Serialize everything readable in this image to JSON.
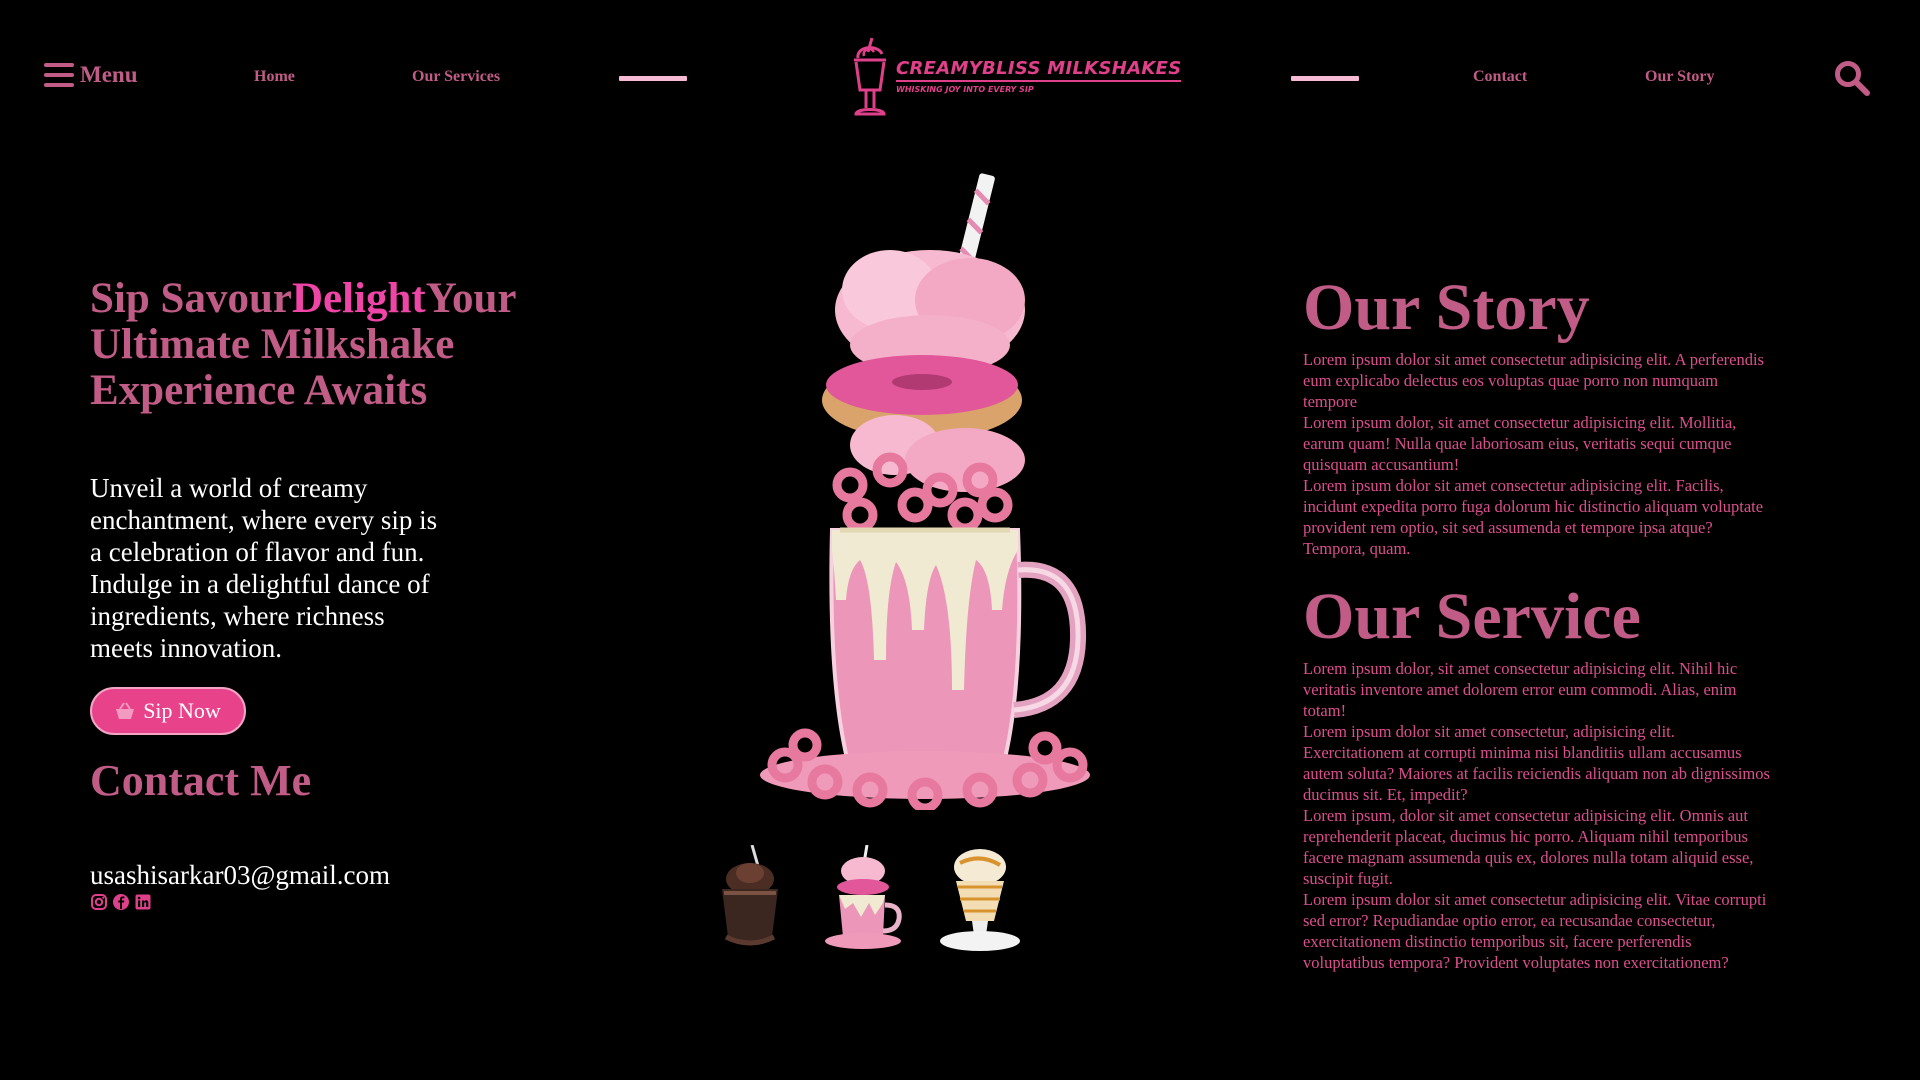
{
  "nav": {
    "menu_label": "Menu",
    "links": [
      "Home",
      "Our Services",
      "Contact",
      "Our Story"
    ],
    "logo_title": "CREAMYBLISS MILKSHAKES",
    "logo_tagline": "WHISKING JOY INTO EVERY SIP",
    "icons": [
      "hamburger-icon",
      "milkshake-glass-icon",
      "search-icon"
    ]
  },
  "hero": {
    "title_part1": "Sip Savour",
    "title_highlight": "Delight",
    "title_part2": "Your Ultimate Milkshake Experience Awaits",
    "description": "Unveil a world of creamy enchantment, where every sip is a celebration of flavor and fun. Indulge in a delightful dance of ingredients, where richness meets innovation.",
    "cta_label": "Sip Now",
    "cta_icon": "basket-icon"
  },
  "contact": {
    "title": "Contact Me",
    "email": "usashisarkar03@gmail.com",
    "social_icons": [
      "instagram-icon",
      "facebook-icon",
      "linkedin-icon"
    ]
  },
  "story": {
    "title": "Our Story",
    "paragraphs": [
      "Lorem ipsum dolor sit amet consectetur adipisicing elit. A perferendis eum explicabo delectus eos voluptas quae porro non numquam tempore",
      "Lorem ipsum dolor, sit amet consectetur adipisicing elit. Mollitia, earum quam! Nulla quae laboriosam eius, veritatis sequi cumque quisquam accusantium!",
      "Lorem ipsum dolor sit amet consectetur adipisicing elit. Facilis, incidunt expedita porro fuga dolorum hic distinctio aliquam voluptate provident rem optio, sit sed assumenda et tempore ipsa atque? Tempora, quam."
    ]
  },
  "service": {
    "title": "Our Service",
    "paragraphs": [
      "Lorem ipsum dolor, sit amet consectetur adipisicing elit. Nihil hic veritatis inventore amet dolorem error eum commodi. Alias, enim totam!",
      "Lorem ipsum dolor sit amet consectetur, adipisicing elit. Exercitationem at corrupti minima nisi blanditiis ullam accusamus autem soluta? Maiores at facilis reiciendis aliquam non ab dignissimos ducimus sit. Et, impedit?",
      "Lorem ipsum, dolor sit amet consectetur adipisicing elit. Omnis aut reprehenderit placeat, ducimus hic porro. Aliquam nihil temporibus facere magnam assumenda quis ex, dolores nulla totam aliquid esse, suscipit fugit.",
      "Lorem ipsum dolor sit amet consectetur adipisicing elit. Vitae corrupti sed error? Repudiandae optio error, ea recusandae consectetur, exercitationem distinctio temporibus sit, facere perferendis voluptatibus tempora? Provident voluptates non exercitationem?"
    ]
  },
  "gallery": {
    "thumbnails": [
      "chocolate-milkshake-thumbnail",
      "pink-freakshake-thumbnail",
      "caramel-milkshake-thumbnail"
    ]
  },
  "colors": {
    "background": "#000000",
    "primary_pink": "#c05c86",
    "highlight_pink": "#ee45a6",
    "button_pink": "#e8438a",
    "logo_pink": "#e0408a",
    "divider_pink": "#f7bad4"
  }
}
